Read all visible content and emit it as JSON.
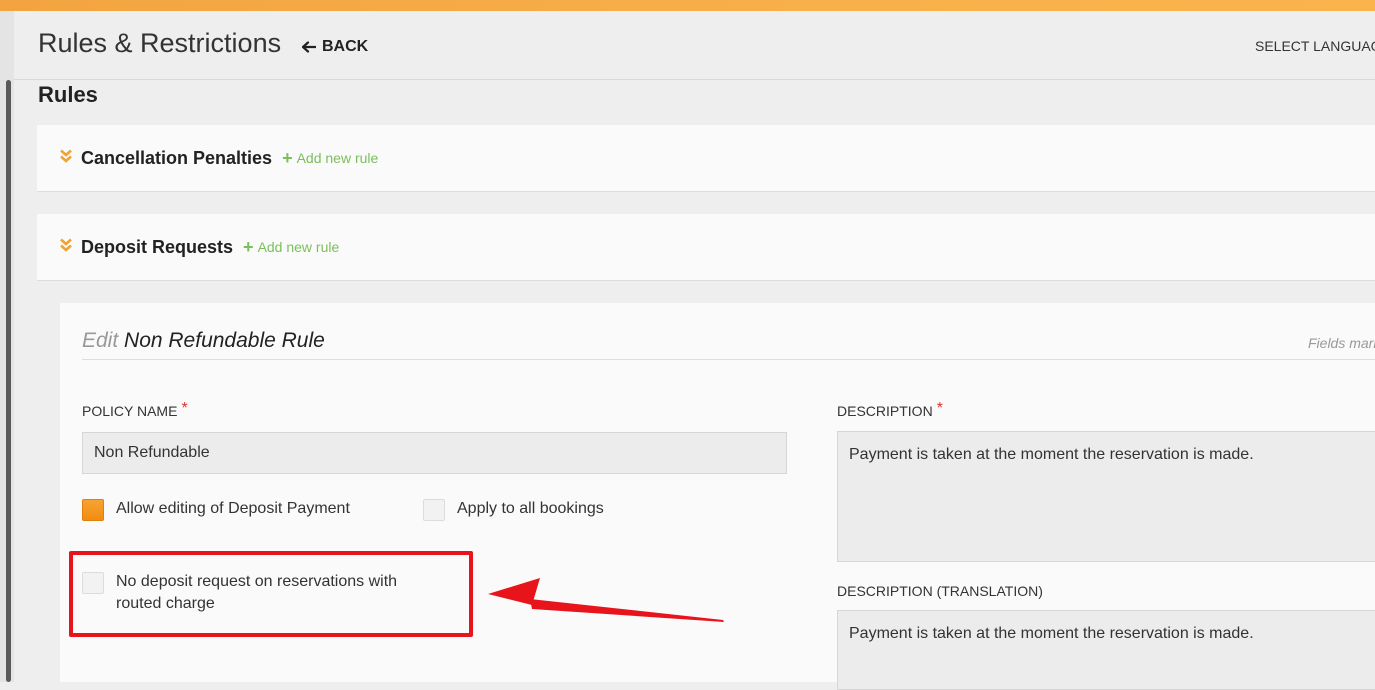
{
  "header": {
    "title": "Rules & Restrictions",
    "back_label": "BACK",
    "language_label": "SELECT LANGUAGE"
  },
  "section_title": "Rules",
  "panels": [
    {
      "title": "Cancellation Penalties",
      "add_label": "Add new rule"
    },
    {
      "title": "Deposit Requests",
      "add_label": "Add new rule"
    }
  ],
  "edit_form": {
    "edit_prefix": "Edit",
    "rule_name": "Non Refundable Rule",
    "fields_note": "Fields marked",
    "policy_name_label": "POLICY NAME",
    "policy_name_value": "Non Refundable",
    "required_mark": "*",
    "description_label": "DESCRIPTION",
    "description_value": "Payment is taken at the moment the reservation is made.",
    "description_translation_label": "DESCRIPTION (TRANSLATION)",
    "description_translation_value": "Payment is taken at the moment the reservation is made.",
    "checkboxes": [
      {
        "label": "Allow editing of Deposit Payment",
        "checked": true
      },
      {
        "label": "Apply to all bookings",
        "checked": false
      },
      {
        "label": "No deposit request on reservations with routed charge",
        "checked": false
      }
    ]
  },
  "colors": {
    "accent_orange": "#f7a432",
    "add_green": "#7bbf5c",
    "required_red": "#e0322b",
    "annotation_red": "#e8141b"
  },
  "icons": {
    "back": "arrow-left-icon",
    "collapse": "double-chevron-down-icon",
    "add": "plus-icon"
  }
}
